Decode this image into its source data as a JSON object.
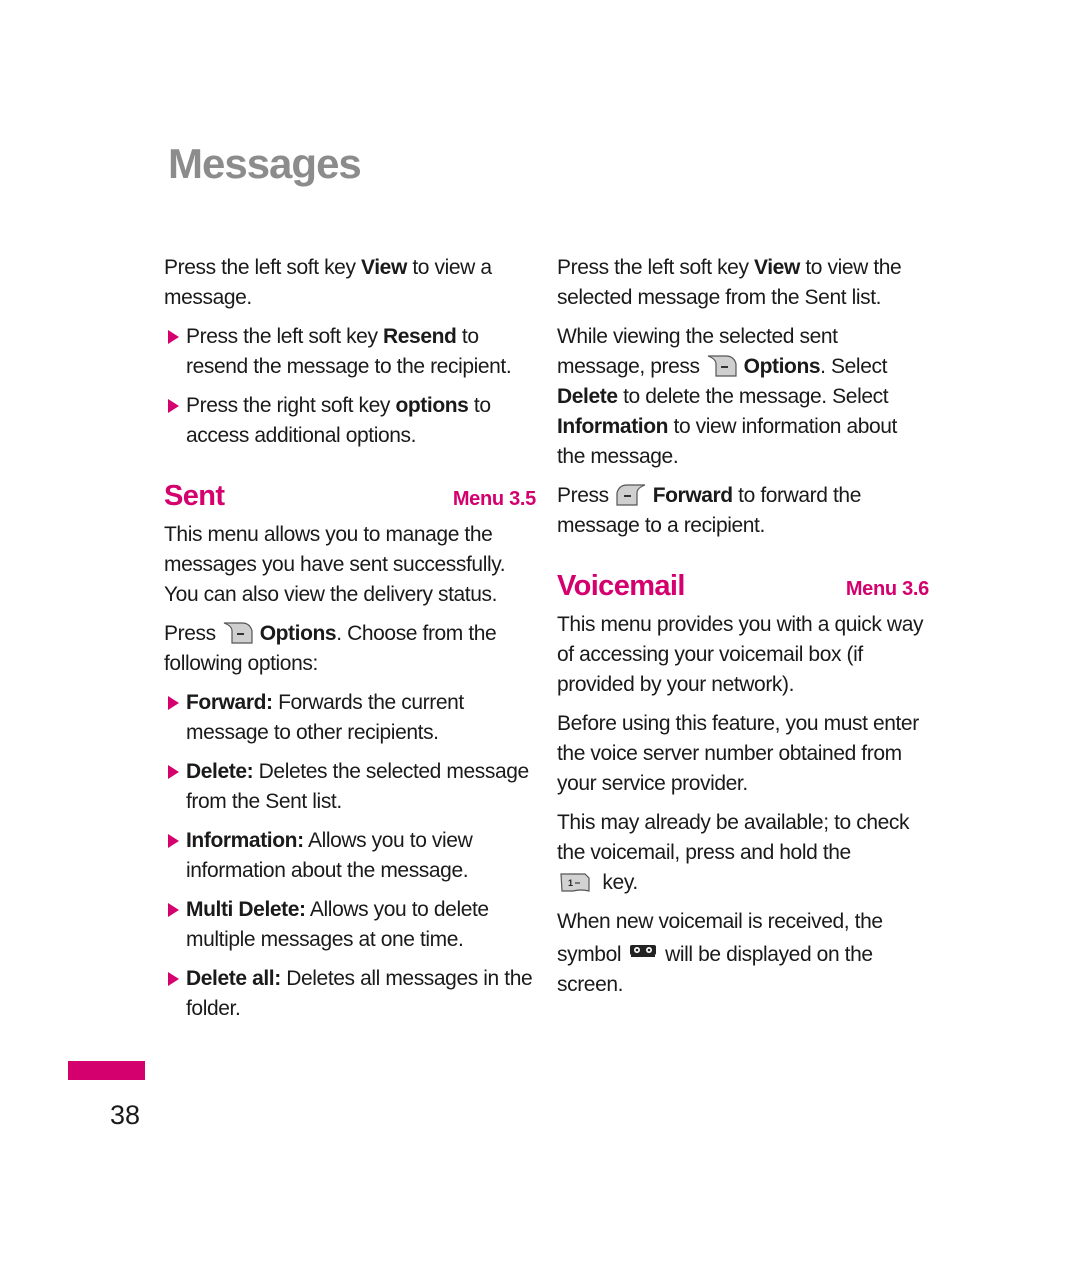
{
  "page": {
    "title": "Messages",
    "page_number": "38",
    "accent_color": "#d4006e",
    "title_color": "#8c8c8c"
  },
  "left": {
    "intro": {
      "t1": "Press the left soft key ",
      "b1": "View",
      "t2": " to view a message."
    },
    "bullets_top": [
      {
        "t1": "Press the left soft key ",
        "b1": "Resend",
        "t2": " to resend the message to the recipient."
      },
      {
        "t1": "Press the right soft key ",
        "b1": "options",
        "t2": " to access additional options."
      }
    ],
    "sent": {
      "title": "Sent",
      "menu": "Menu 3.5",
      "desc": "This menu allows you to manage the messages you have sent successfully. You can also view the delivery status.",
      "press_t1": "Press",
      "press_b1": "Options",
      "press_t2": ". Choose from the following options:",
      "options": [
        {
          "label": "Forward:",
          "desc": " Forwards the current message to other recipients."
        },
        {
          "label": "Delete:",
          "desc": " Deletes the selected message from the Sent list."
        },
        {
          "label": "Information:",
          "desc": " Allows you to view information about the message."
        },
        {
          "label": "Multi Delete:",
          "desc": " Allows you to delete multiple messages at one time."
        },
        {
          "label": "Delete all:",
          "desc": " Deletes all messages in the folder."
        }
      ]
    }
  },
  "right": {
    "p1": {
      "t1": "Press the left soft key ",
      "b1": "View",
      "t2": " to view the selected message from the Sent list."
    },
    "p2": {
      "t1": "While viewing the selected sent message, press",
      "b1": "Options",
      "t2": ". Select ",
      "b2": "Delete",
      "t3": " to delete the message. Select ",
      "b3": "Information",
      "t4": " to view information about the message."
    },
    "p3": {
      "t1": "Press",
      "b1": "Forward",
      "t2": " to forward the message to a recipient."
    },
    "voicemail": {
      "title": "Voicemail",
      "menu": "Menu 3.6",
      "p1": "This menu provides you with a quick way of accessing your voicemail box (if provided by your network).",
      "p2": "Before using this feature, you must enter the voice server number obtained from your service provider.",
      "p3_t1": "This may already be available; to check the voicemail, press and hold the",
      "p3_key": "1",
      "p3_t2": " key.",
      "p4_t1": "When new voicemail is received, the symbol",
      "p4_t2": "will be displayed on the screen."
    }
  }
}
